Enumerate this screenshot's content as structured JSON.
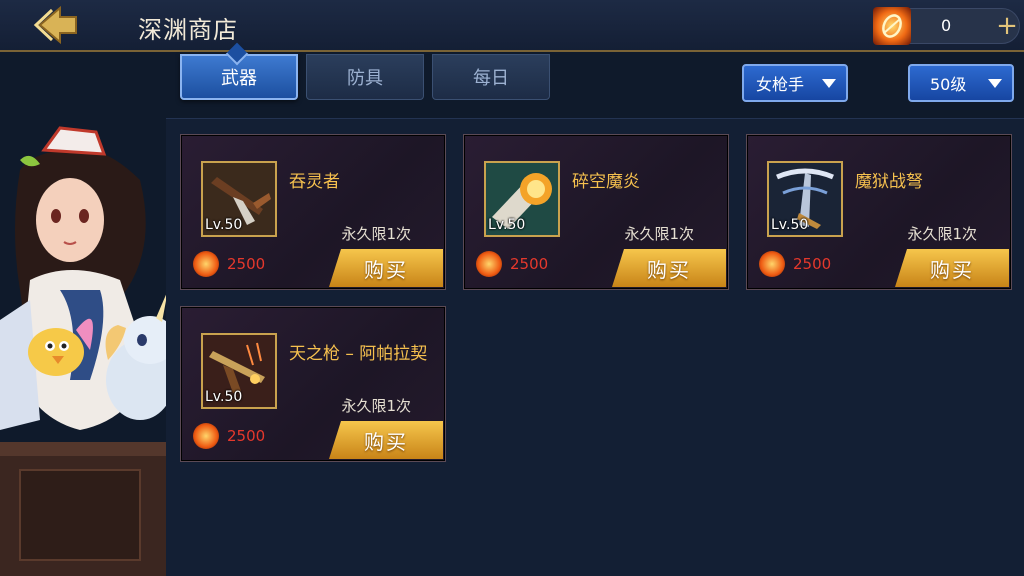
{
  "header": {
    "title": "深渊商店",
    "currency_amount": "0",
    "plus_label": "+"
  },
  "tabs": [
    {
      "label": "武器",
      "active": true
    },
    {
      "label": "防具",
      "active": false
    },
    {
      "label": "每日",
      "active": false
    }
  ],
  "filters": {
    "class_filter": "女枪手",
    "level_filter": "50级"
  },
  "items": [
    {
      "name": "吞灵者",
      "level": "Lv.50",
      "limit": "永久限1次",
      "price": "2500",
      "buy_label": "购买",
      "icon": "gun-icon"
    },
    {
      "name": "碎空魔炎",
      "level": "Lv.50",
      "limit": "永久限1次",
      "price": "2500",
      "buy_label": "购买",
      "icon": "flame-cannon-icon"
    },
    {
      "name": "魔狱战弩",
      "level": "Lv.50",
      "limit": "永久限1次",
      "price": "2500",
      "buy_label": "购买",
      "icon": "crossbow-icon"
    },
    {
      "name": "天之枪 – 阿帕拉契",
      "level": "Lv.50",
      "limit": "永久限1次",
      "price": "2500",
      "buy_label": "购买",
      "icon": "rifle-icon"
    }
  ],
  "colors": {
    "accent_gold": "#f5c04e",
    "price_red": "#e5382c",
    "tab_blue": "#1c4fa0"
  }
}
